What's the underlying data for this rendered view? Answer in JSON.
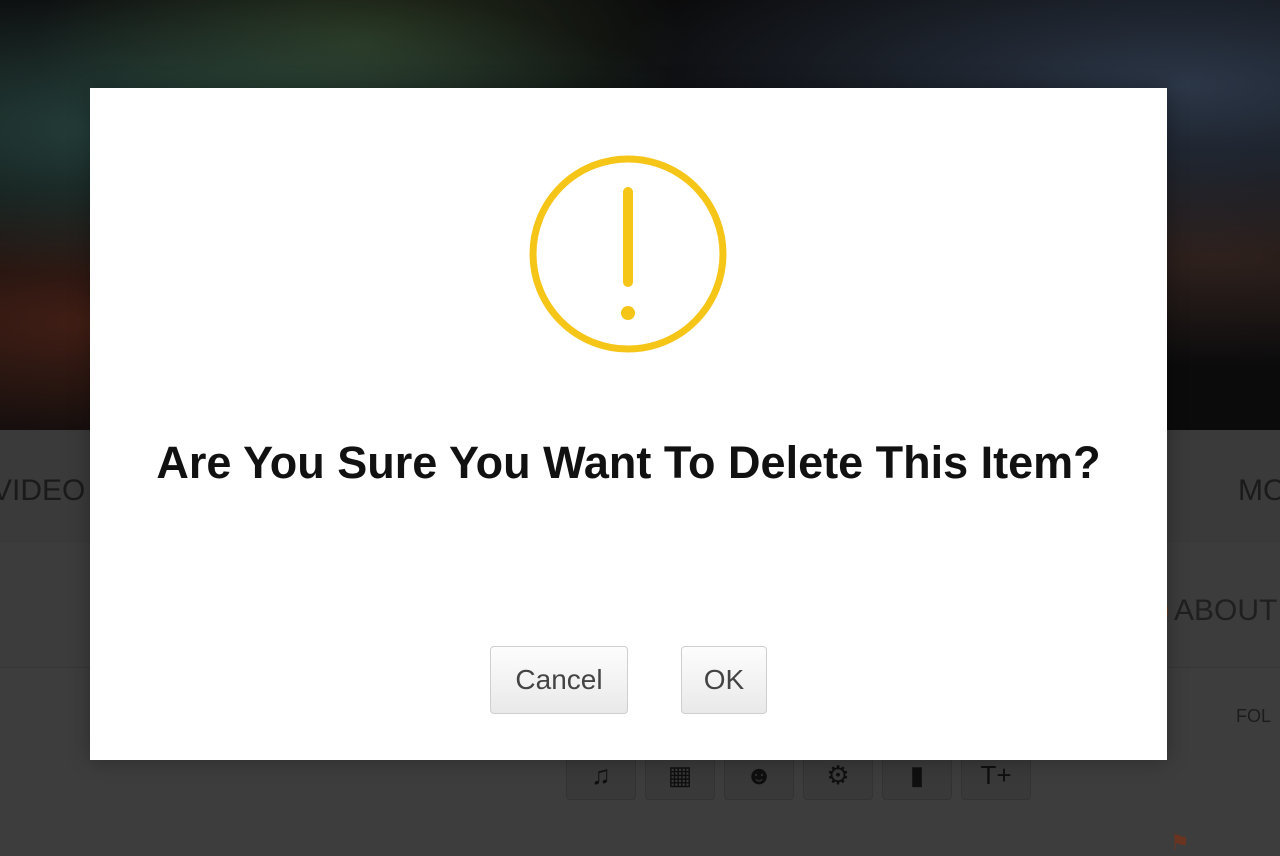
{
  "background": {
    "nav_left": "VIDEO",
    "nav_right": "MO",
    "about_label": "ABOUT",
    "follow_label": "FOL",
    "toolbar_icons": [
      "music-icon",
      "grid-icon",
      "user-icon",
      "gear-icon",
      "trash-icon",
      "text-size-icon"
    ]
  },
  "dialog": {
    "icon": "warning-icon",
    "icon_color": "#F5C518",
    "title": "Are You Sure You Want To Delete This Item?",
    "cancel_label": "Cancel",
    "ok_label": "OK"
  }
}
